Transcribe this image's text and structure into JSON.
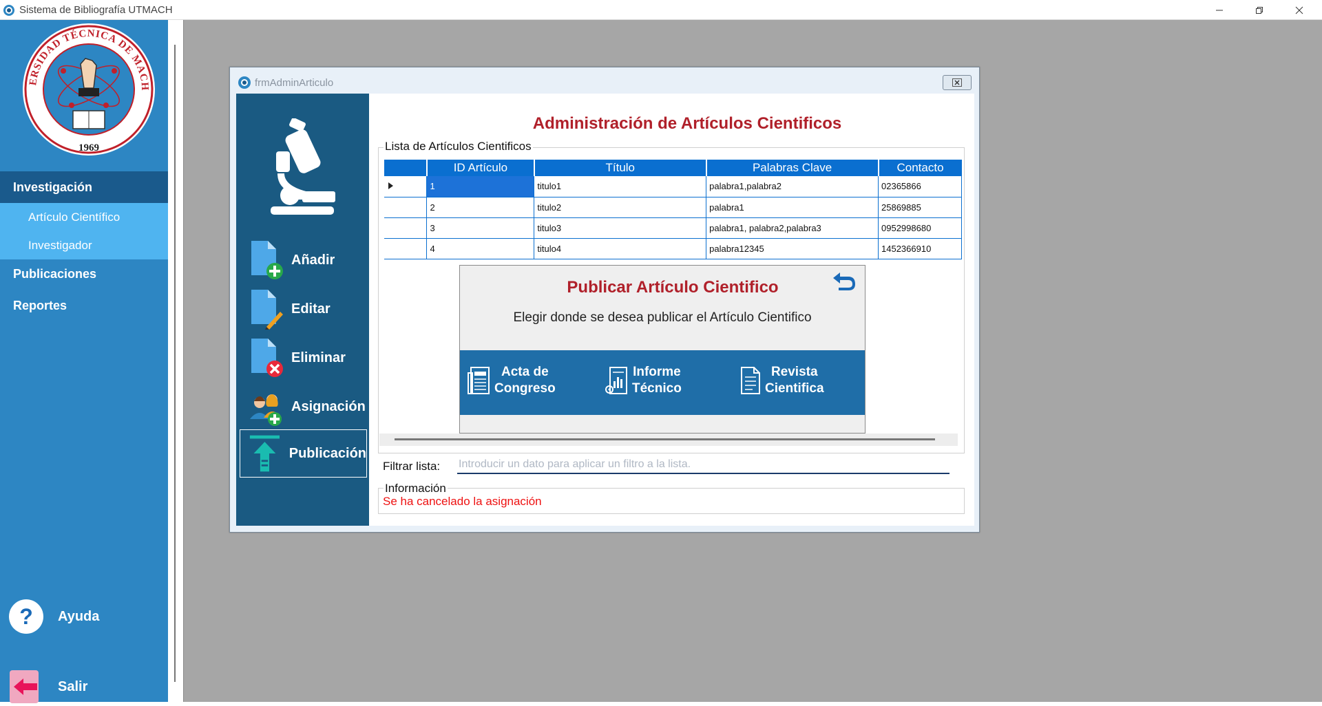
{
  "window": {
    "title": "Sistema de Bibliografía UTMACH"
  },
  "sidebar": {
    "logo": {
      "text_top": "UNIVERSIDAD TÉCNICA DE MACHALA",
      "year": "1969"
    },
    "sections": [
      {
        "label": "Investigación",
        "items": [
          "Artículo Científico",
          "Investigador"
        ]
      },
      {
        "label": "Publicaciones"
      },
      {
        "label": "Reportes"
      }
    ],
    "help_label": "Ayuda",
    "exit_label": "Salir"
  },
  "child_window": {
    "title": "frmAdminArticulo",
    "actions": [
      {
        "label": "Añadir",
        "icon": "add-document-icon"
      },
      {
        "label": "Editar",
        "icon": "edit-document-icon"
      },
      {
        "label": "Eliminar",
        "icon": "delete-document-icon"
      },
      {
        "label": "Asignación",
        "icon": "assign-users-icon"
      },
      {
        "label": "Publicación",
        "icon": "upload-arrow-icon"
      }
    ],
    "main_title": "Administración de Artículos Cientificos",
    "list_group_label": "Lista de Artículos Cientificos",
    "table": {
      "columns": [
        "ID Artículo",
        "Título",
        "Palabras Clave",
        "Contacto"
      ],
      "rows": [
        {
          "id": "1",
          "titulo": "titulo1",
          "palabras": "palabra1,palabra2",
          "contacto": "02365866"
        },
        {
          "id": "2",
          "titulo": "titulo2",
          "palabras": "palabra1",
          "contacto": "25869885"
        },
        {
          "id": "3",
          "titulo": "titulo3",
          "palabras": "palabra1, palabra2,palabra3",
          "contacto": "0952998680"
        },
        {
          "id": "4",
          "titulo": "titulo4",
          "palabras": "palabra12345",
          "contacto": "1452366910"
        }
      ]
    },
    "publish_panel": {
      "title": "Publicar Artículo Cientifico",
      "subtitle": "Elegir donde se desea publicar el Artículo Cientifico",
      "options": [
        {
          "line1": "Acta de",
          "line2": "Congreso"
        },
        {
          "line1": "Informe",
          "line2": "Técnico"
        },
        {
          "line1": "Revista",
          "line2": "Cientifica"
        }
      ]
    },
    "filter": {
      "label": "Filtrar lista:",
      "placeholder": "Introducir un dato para aplicar un filtro a la lista.",
      "value": ""
    },
    "info": {
      "label": "Información",
      "message": "Se ha cancelado la asignación"
    }
  },
  "colors": {
    "sidebar": "#2d86c3",
    "sidebar_active": "#1a5a8c",
    "sidebar_sub": "#4fb4f0",
    "inner_panel": "#1a5a82",
    "title_red": "#b0202a",
    "grid_header": "#0a6fd0",
    "info_red": "#ee1111"
  }
}
